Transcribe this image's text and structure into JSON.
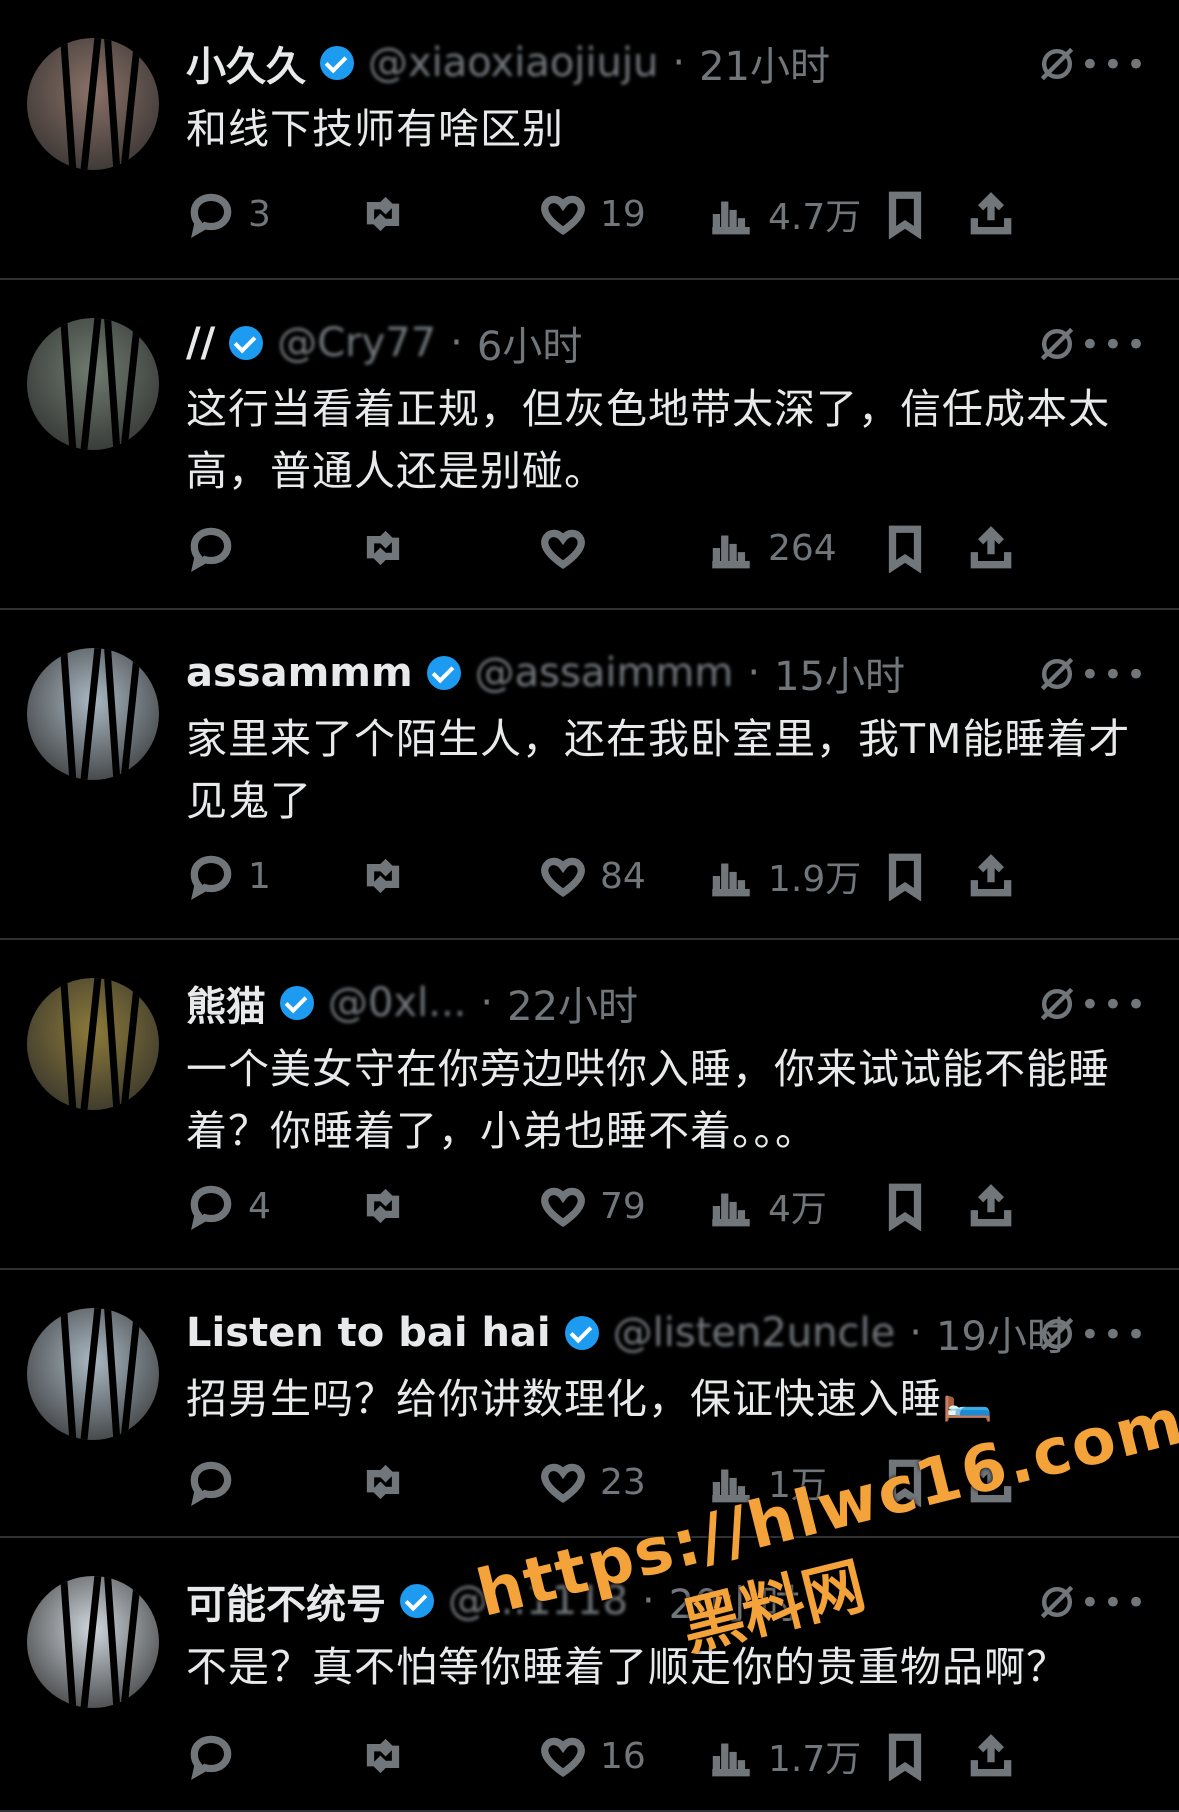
{
  "posts": [
    {
      "name": "小久久",
      "handle": "@xiaoxiaojiuju",
      "time": "21小时",
      "text": "和线下技师有啥区别",
      "replies": "3",
      "likes": "19",
      "views": "4.7万",
      "avatar_color": "#8a7168"
    },
    {
      "name": "//",
      "handle": "@Cry77",
      "time": "6小时",
      "text": "这行当看着正规，但灰色地带太深了，信任成本太高，普通人还是别碰。",
      "replies": "",
      "likes": "",
      "views": "264",
      "avatar_color": "#6f7b70"
    },
    {
      "name": "assammm",
      "handle": "@assaimmm",
      "time": "15小时",
      "text": "家里来了个陌生人，还在我卧室里，我TM能睡着才见鬼了",
      "replies": "1",
      "likes": "84",
      "views": "1.9万",
      "avatar_color": "#aab8c2"
    },
    {
      "name": "熊猫",
      "handle": "@0xl...",
      "time": "22小时",
      "text": "一个美女守在你旁边哄你入睡，你来试试能不能睡着？你睡着了，小弟也睡不着。。。",
      "replies": "4",
      "likes": "79",
      "views": "4万",
      "avatar_color": "#8c7a3a"
    },
    {
      "name": "Listen to bai hai",
      "handle": "@listen2uncle",
      "time": "19小时",
      "text": "招男生吗？给你讲数理化，保证快速入睡🛏️",
      "replies": "",
      "likes": "23",
      "views": "1万",
      "avatar_color": "#aab8c2"
    },
    {
      "name": "可能不统号",
      "handle": "@...1118",
      "time": "20小时",
      "text": "不是？真不怕等你睡着了顺走你的贵重物品啊？",
      "replies": "",
      "likes": "16",
      "views": "1.7万",
      "avatar_color": "#cfd6dc"
    }
  ],
  "watermark": {
    "url": "https://hlwc16.com",
    "site": "黑料网",
    "color": "#f4a23a"
  },
  "icons": {
    "reply": "reply-icon",
    "retweet": "retweet-icon",
    "like": "like-icon",
    "views": "views-icon",
    "bookmark": "bookmark-icon",
    "share": "share-icon",
    "grok": "grok-icon",
    "more": "more-icon"
  }
}
